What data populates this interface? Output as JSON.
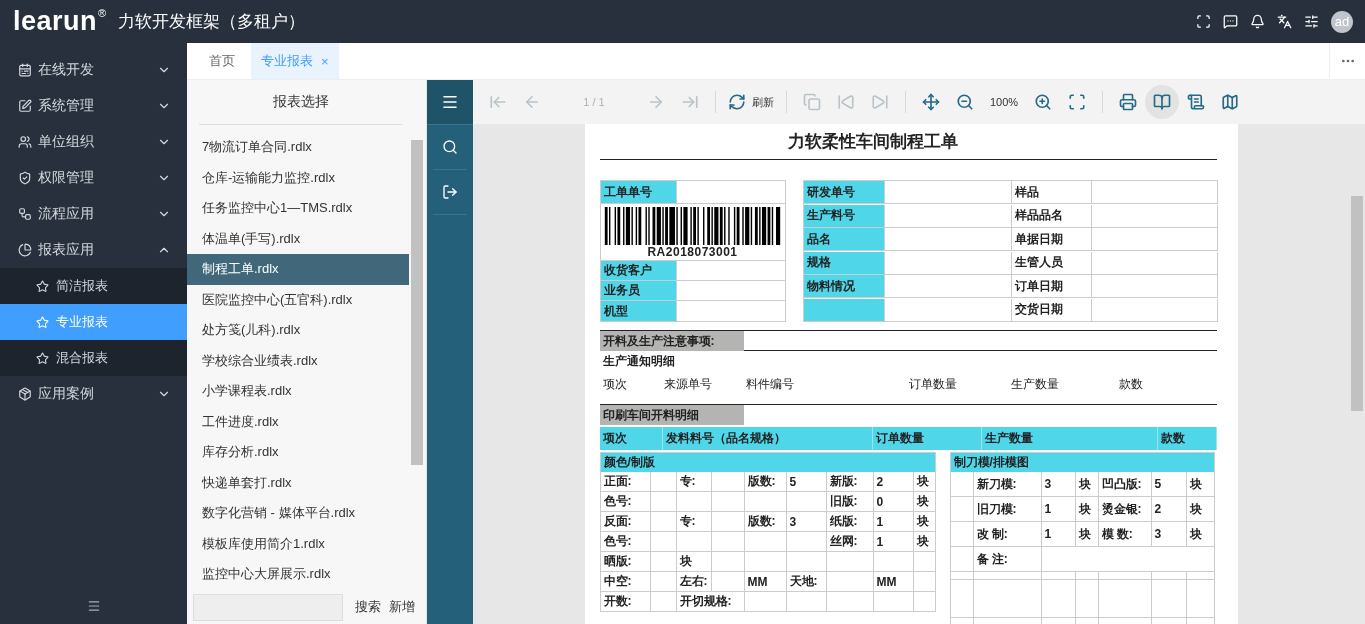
{
  "header": {
    "logo": "learun",
    "logo_mark": "®",
    "title": "力软开发框架（多租户）",
    "avatar": "ad"
  },
  "sidebar": {
    "items": [
      {
        "label": "在线开发",
        "expanded": false
      },
      {
        "label": "系统管理",
        "expanded": false
      },
      {
        "label": "单位组织",
        "expanded": false
      },
      {
        "label": "权限管理",
        "expanded": false
      },
      {
        "label": "流程应用",
        "expanded": false
      },
      {
        "label": "报表应用",
        "expanded": true,
        "children": [
          {
            "label": "简洁报表",
            "selected": false
          },
          {
            "label": "专业报表",
            "selected": true
          },
          {
            "label": "混合报表",
            "selected": false
          }
        ]
      },
      {
        "label": "应用案例",
        "expanded": false
      }
    ]
  },
  "tabs": [
    {
      "label": "首页",
      "selected": false
    },
    {
      "label": "专业报表",
      "selected": true,
      "close": "×"
    }
  ],
  "report_list": {
    "title": "报表选择",
    "items": [
      {
        "label": "7物流订单合同.rdlx",
        "selected": false
      },
      {
        "label": "仓库-运输能力监控.rdlx",
        "selected": false
      },
      {
        "label": "任务监控中心1—TMS.rdlx",
        "selected": false
      },
      {
        "label": "体温单(手写).rdlx",
        "selected": false
      },
      {
        "label": "制程工单.rdlx",
        "selected": true
      },
      {
        "label": "医院监控中心(五官科).rdlx",
        "selected": false
      },
      {
        "label": "处方笺(儿科).rdlx",
        "selected": false
      },
      {
        "label": "学校综合业绩表.rdlx",
        "selected": false
      },
      {
        "label": "小学课程表.rdlx",
        "selected": false
      },
      {
        "label": "工件进度.rdlx",
        "selected": false
      },
      {
        "label": "库存分析.rdlx",
        "selected": false
      },
      {
        "label": "快递单套打.rdlx",
        "selected": false
      },
      {
        "label": "数字化营销 - 媒体平台.rdlx",
        "selected": false
      },
      {
        "label": "模板库使用简介1.rdlx",
        "selected": false
      },
      {
        "label": "监控中心大屏展示.rdlx",
        "selected": false
      }
    ],
    "search_button": "搜索",
    "add_button": "新增"
  },
  "toolbar": {
    "items": [
      {
        "kind": "first",
        "disabled": true
      },
      {
        "kind": "prev",
        "disabled": true
      },
      {
        "kind": "page",
        "label": "1 / 1",
        "disabled": true
      },
      {
        "kind": "next",
        "disabled": true
      },
      {
        "kind": "last",
        "disabled": true
      },
      {
        "kind": "separator"
      },
      {
        "kind": "refresh",
        "label": "刷新",
        "disabled": false
      },
      {
        "kind": "separator"
      },
      {
        "kind": "copy",
        "disabled": true
      },
      {
        "kind": "prev-section",
        "disabled": true
      },
      {
        "kind": "next-section",
        "disabled": true
      },
      {
        "kind": "separator"
      },
      {
        "kind": "pan",
        "disabled": false
      },
      {
        "kind": "zoom-out",
        "disabled": false
      },
      {
        "kind": "zoom",
        "label": "100%",
        "disabled": false
      },
      {
        "kind": "zoom-in",
        "disabled": false
      },
      {
        "kind": "fit",
        "disabled": false
      },
      {
        "kind": "separator"
      },
      {
        "kind": "print",
        "disabled": false
      },
      {
        "kind": "book",
        "selected": true
      },
      {
        "kind": "scroll",
        "selected": false
      },
      {
        "kind": "map",
        "selected": false
      }
    ]
  },
  "document": {
    "title": "力软柔性车间制程工单",
    "order": {
      "label": "工单单号",
      "barcode": "RA2018073001",
      "fields": [
        "收货客户",
        "业务员",
        "机型"
      ]
    },
    "info": [
      {
        "left": "研发单号",
        "right": "样品"
      },
      {
        "left": "生产料号",
        "right": "样品品名"
      },
      {
        "left": "品名",
        "right": "单据日期"
      },
      {
        "left": "规格",
        "right": "生管人员"
      },
      {
        "left": "物料情况",
        "right": "订单日期"
      },
      {
        "right": "交货日期"
      }
    ],
    "notes_label": "开料及生产注意事项:",
    "notice": {
      "title": "生产通知明细",
      "columns": [
        "项次",
        "来源单号",
        "料件编号",
        "订单数量",
        "生产数量",
        "款数"
      ]
    },
    "print_section": {
      "title": "印刷车间开料明细",
      "columns": [
        "项次",
        "发料料号（品名规格）",
        "订单数量",
        "生产数量",
        "款数"
      ]
    },
    "plate": {
      "title": "颜色/制版",
      "rows": [
        [
          "正面:",
          null,
          "专:",
          null,
          "版数:",
          "5",
          "新版:",
          "2",
          "块"
        ],
        [
          "色号:",
          null,
          null,
          null,
          null,
          null,
          "旧版:",
          "0",
          "块"
        ],
        [
          "反面:",
          null,
          "专:",
          null,
          "版数:",
          "3",
          "纸版:",
          "1",
          "块"
        ],
        [
          "色号:",
          null,
          null,
          null,
          null,
          null,
          "丝网:",
          "1",
          "块"
        ],
        [
          "晒版:",
          null,
          "块",
          null,
          null,
          null,
          null,
          null,
          null
        ],
        [
          "中空:",
          null,
          "左右:",
          null,
          "MM",
          "天地:",
          null,
          "MM",
          null
        ],
        [
          "开数:",
          null,
          {
            "text": "开切规格:",
            "kind": "wide"
          },
          null,
          null,
          null,
          null,
          null
        ]
      ]
    },
    "die": {
      "title": "制刀模/排模图",
      "rows": [
        [
          null,
          "新刀模:",
          "3",
          "块",
          "凹凸版:",
          "5",
          "块"
        ],
        [
          null,
          "旧刀模:",
          "1",
          "块",
          "烫金银:",
          "2",
          "块"
        ],
        [
          null,
          "改 制:",
          "1",
          "块",
          "模 数:",
          "3",
          "块"
        ]
      ],
      "remark": "备 注:"
    }
  }
}
